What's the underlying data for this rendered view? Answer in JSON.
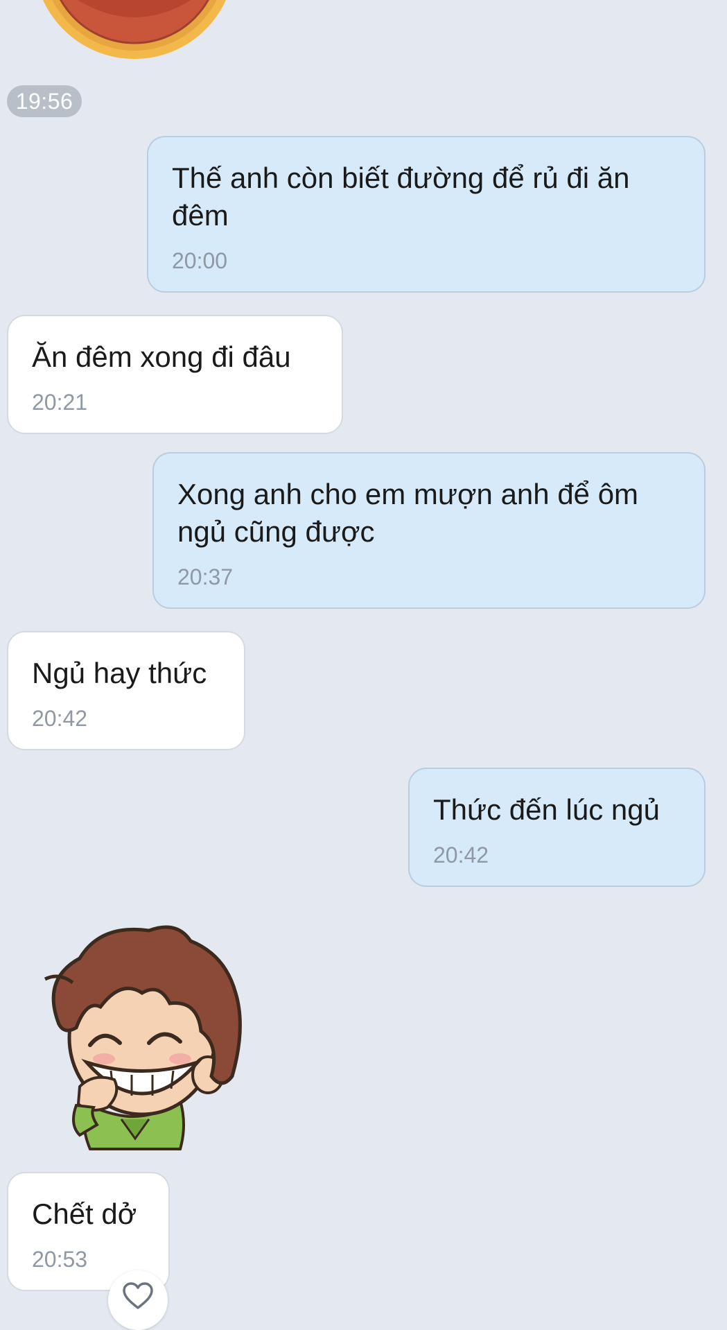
{
  "date_badge": "19:56",
  "messages": [
    {
      "text": "Thế anh còn biết đường để rủ đi ăn\nđêm",
      "time": "20:00",
      "direction": "outgoing"
    },
    {
      "text": "Ăn đêm xong đi đâu",
      "time": "20:21",
      "direction": "incoming"
    },
    {
      "text": "Xong anh cho em mượn anh để ôm\nngủ cũng được",
      "time": "20:37",
      "direction": "outgoing"
    },
    {
      "text": "Ngủ hay thức",
      "time": "20:42",
      "direction": "incoming"
    },
    {
      "text": "Thức đến lúc ngủ",
      "time": "20:42",
      "direction": "outgoing"
    },
    {
      "text": "Chết dở",
      "time": "20:53",
      "direction": "incoming"
    }
  ],
  "stickers": [
    {
      "icon": "medal-sticker",
      "direction": "incoming"
    },
    {
      "icon": "grinning-boy-sticker",
      "direction": "incoming"
    }
  ],
  "reaction": {
    "icon": "heart-outline-icon"
  },
  "colors": {
    "background": "#e4e8f0",
    "outgoing_bubble": "#d6eafa",
    "incoming_bubble": "#ffffff",
    "time_text": "#8f98a3"
  }
}
